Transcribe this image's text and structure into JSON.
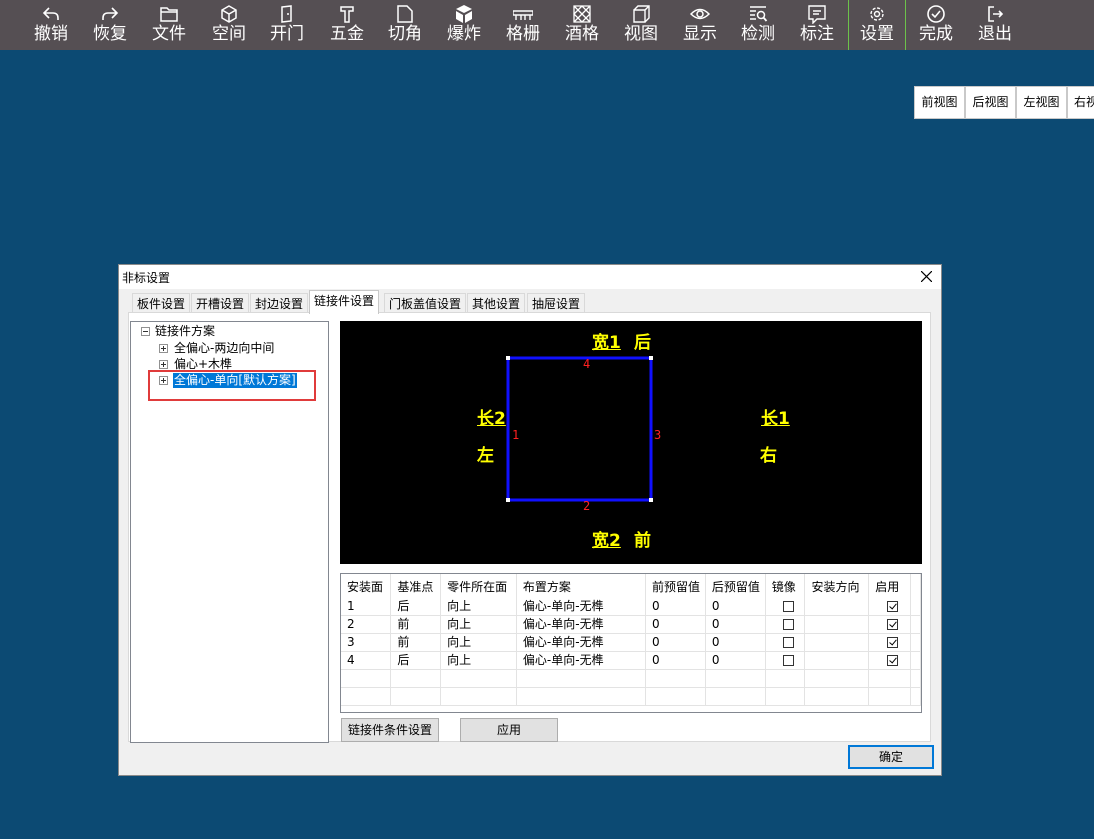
{
  "toolbar": {
    "items": [
      {
        "label": "撤销",
        "icon": "undo-icon"
      },
      {
        "label": "恢复",
        "icon": "redo-icon"
      },
      {
        "label": "文件",
        "icon": "folder-icon"
      },
      {
        "label": "空间",
        "icon": "cube-outline-icon"
      },
      {
        "label": "开门",
        "icon": "door-icon"
      },
      {
        "label": "五金",
        "icon": "hardware-icon"
      },
      {
        "label": "切角",
        "icon": "cut-corner-icon"
      },
      {
        "label": "爆炸",
        "icon": "explode-icon"
      },
      {
        "label": "格栅",
        "icon": "grille-icon"
      },
      {
        "label": "酒格",
        "icon": "wine-rack-icon"
      },
      {
        "label": "视图",
        "icon": "view-box-icon"
      },
      {
        "label": "显示",
        "icon": "eye-icon"
      },
      {
        "label": "检测",
        "icon": "inspect-icon"
      },
      {
        "label": "标注",
        "icon": "annotation-icon"
      },
      {
        "label": "设置",
        "icon": "gear-icon"
      },
      {
        "label": "完成",
        "icon": "check-circle-icon"
      },
      {
        "label": "退出",
        "icon": "exit-icon"
      }
    ],
    "separator_color": "#6cc24a"
  },
  "viewbar": {
    "buttons": [
      "前视图",
      "后视图",
      "左视图",
      "右视图"
    ]
  },
  "dialog": {
    "title": "非标设置",
    "tabs": [
      "板件设置",
      "开槽设置",
      "封边设置",
      "链接件设置",
      "门板盖值设置",
      "其他设置",
      "抽屉设置"
    ],
    "active_tab": "链接件设置",
    "tree": {
      "root": "链接件方案",
      "children": [
        "全偏心-两边向中间",
        "偏心+木榫",
        "全偏心-单向[默认方案]"
      ],
      "selected": "全偏心-单向[默认方案]"
    },
    "diagram": {
      "top_label": "宽1",
      "top_side": "后",
      "bottom_label": "宽2",
      "bottom_side": "前",
      "left_label": "长2",
      "left_side": "左",
      "right_label": "长1",
      "right_side": "右",
      "edge_numbers": [
        "1",
        "2",
        "3",
        "4"
      ],
      "rect_color": "#1010ff",
      "text_color": "#ffff00",
      "number_color": "#ff2020"
    },
    "grid": {
      "headers": [
        "安装面",
        "基准点",
        "零件所在面",
        "布置方案",
        "前预留值",
        "后预留值",
        "镜像",
        "安装方向",
        "启用"
      ],
      "rows": [
        {
          "face": "1",
          "base": "后",
          "part_face": "向上",
          "scheme": "偏心-单向-无榫",
          "front": "0",
          "back": "0",
          "mirror": false,
          "direction": "",
          "enabled": true
        },
        {
          "face": "2",
          "base": "前",
          "part_face": "向上",
          "scheme": "偏心-单向-无榫",
          "front": "0",
          "back": "0",
          "mirror": false,
          "direction": "",
          "enabled": true
        },
        {
          "face": "3",
          "base": "前",
          "part_face": "向上",
          "scheme": "偏心-单向-无榫",
          "front": "0",
          "back": "0",
          "mirror": false,
          "direction": "",
          "enabled": true
        },
        {
          "face": "4",
          "base": "后",
          "part_face": "向上",
          "scheme": "偏心-单向-无榫",
          "front": "0",
          "back": "0",
          "mirror": false,
          "direction": "",
          "enabled": true
        }
      ]
    },
    "buttons": {
      "condition": "链接件条件设置",
      "apply": "应用",
      "ok": "确定"
    }
  }
}
